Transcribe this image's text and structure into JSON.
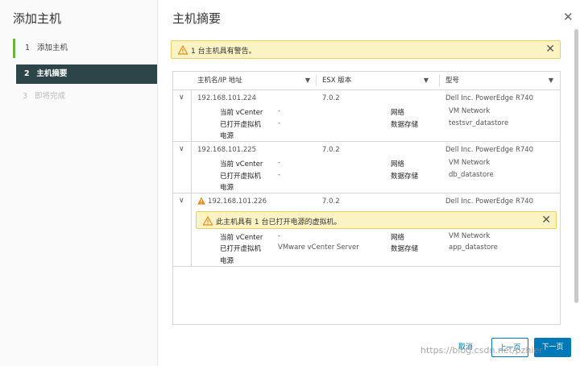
{
  "wizard": {
    "title": "添加主机",
    "steps": [
      {
        "num": "1",
        "label": "添加主机"
      },
      {
        "num": "2",
        "label": "主机摘要"
      },
      {
        "num": "3",
        "label": "即将完成"
      }
    ]
  },
  "main": {
    "title": "主机摘要",
    "alert": "1 台主机具有警告。",
    "columns": [
      "主机名/IP 地址",
      "ESX 版本",
      "型号"
    ],
    "hosts": [
      {
        "ip": "192.168.101.224",
        "version": "7.0.2",
        "model": "Dell Inc. PowerEdge R740",
        "vcenter_label": "当前 vCenter",
        "vcenter_value": "-",
        "vm_label": "已打开虚拟机",
        "vm_value": "-",
        "power_label": "电源",
        "network_label": "网络",
        "network_value": "VM Network",
        "datastore_label": "数据存储",
        "datastore_value": "testsvr_datastore"
      },
      {
        "ip": "192.168.101.225",
        "version": "7.0.2",
        "model": "Dell Inc. PowerEdge R740",
        "vcenter_label": "当前 vCenter",
        "vcenter_value": "-",
        "vm_label": "已打开虚拟机",
        "vm_value": "-",
        "power_label": "电源",
        "network_label": "网络",
        "network_value": "VM Network",
        "datastore_label": "数据存储",
        "datastore_value": "db_datastore"
      },
      {
        "ip": "192.168.101.226",
        "version": "7.0.2",
        "model": "Dell Inc. PowerEdge R740",
        "warning": "此主机具有 1 台已打开电源的虚拟机。",
        "vcenter_label": "当前 vCenter",
        "vcenter_value": "-",
        "vm_label": "已打开虚拟机",
        "vm_value": "VMware vCenter Server",
        "power_label": "电源",
        "network_label": "网络",
        "network_value": "VM Network",
        "datastore_label": "数据存储",
        "datastore_value": "app_datastore"
      }
    ]
  },
  "footer": {
    "cancel": "取消",
    "back": "上一页",
    "next": "下一页"
  },
  "watermark": "https://blog.csdn.net/pzhier",
  "icons": {
    "close": "close-icon",
    "warning": "warning-icon",
    "filter": "filter-icon",
    "chevron": "chevron-down-icon"
  },
  "colors": {
    "active_step_bg": "#2d4548",
    "completed_step_bar": "#6db33f",
    "primary": "#0079b8",
    "warning_bg": "#fbf3c4",
    "warning_icon": "#e58a1f"
  }
}
